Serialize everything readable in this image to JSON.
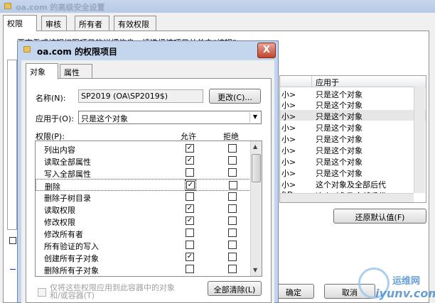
{
  "background_window": {
    "title": "oa.com 的高级安全设置",
    "tabs": [
      {
        "label": "权限",
        "active": true
      },
      {
        "label": "审核",
        "active": false
      },
      {
        "label": "所有者",
        "active": false
      },
      {
        "label": "有效权限",
        "active": false
      }
    ],
    "description": "要查看或编辑权限项目的详细信息，请选择该项目并单击“编辑”。",
    "list_header": {
      "applies_to": "应用于"
    },
    "list_rows": [
      {
        "prefix": "小>",
        "applies_to": "只是这个对象",
        "selected": false
      },
      {
        "prefix": "小>",
        "applies_to": "只是这个对象",
        "selected": false
      },
      {
        "prefix": "小>",
        "applies_to": "只是这个对象",
        "selected": true
      },
      {
        "prefix": "小>",
        "applies_to": "只是这个对象",
        "selected": false
      },
      {
        "prefix": "小>",
        "applies_to": "只是这个对象",
        "selected": false
      },
      {
        "prefix": "小>",
        "applies_to": "只是这个对象",
        "selected": false
      },
      {
        "prefix": "小>",
        "applies_to": "只是这个对象",
        "selected": false
      },
      {
        "prefix": "小>",
        "applies_to": "只是这个对象",
        "selected": false
      },
      {
        "prefix": "小>",
        "applies_to": "这个对象及全部后代",
        "selected": false
      },
      {
        "prefix": "ftD>",
        "applies_to": "这个对象及全部后代",
        "selected": false
      }
    ],
    "restore_defaults_button": "还原默认值(F)",
    "ok_button": "确定",
    "cancel_button": "取消"
  },
  "dialog": {
    "title": "oa.com 的权限项目",
    "close_label": "X",
    "tabs": [
      {
        "label": "对象",
        "active": true
      },
      {
        "label": "属性",
        "active": false
      }
    ],
    "name_label": "名称(N):",
    "name_value": "SP2019 (OA\\SP2019$)",
    "change_button": "更改(C)...",
    "apply_to_label": "应用于(O):",
    "apply_to_value": "只是这个对象",
    "permissions_label": "权限(P):",
    "allow_header": "允许",
    "deny_header": "拒绝",
    "check_mark": "✓",
    "permissions": [
      {
        "name": "列出内容",
        "allow": true,
        "deny": false
      },
      {
        "name": "读取全部属性",
        "allow": true,
        "deny": false
      },
      {
        "name": "写入全部属性",
        "allow": false,
        "deny": false
      },
      {
        "name": "删除",
        "allow": true,
        "deny": false
      },
      {
        "name": "删除子树目录",
        "allow": false,
        "deny": false
      },
      {
        "name": "读取权限",
        "allow": true,
        "deny": false
      },
      {
        "name": "修改权限",
        "allow": true,
        "deny": false
      },
      {
        "name": "修改所有者",
        "allow": false,
        "deny": false
      },
      {
        "name": "所有验证的写入",
        "allow": false,
        "deny": false
      },
      {
        "name": "创建所有子对象",
        "allow": true,
        "deny": false
      },
      {
        "name": "删除所有子对象",
        "allow": false,
        "deny": false
      }
    ],
    "apply_only_text_line1": "仅将这些权限应用到此容器中的对象",
    "apply_only_text_line2": "和/或容器(T)",
    "clear_all_button": "全部清除(L)"
  },
  "watermark": {
    "text_line1": "运维网",
    "text_line2": "iyunv.com"
  },
  "colors": {
    "dialog_frame": "#c4d5ee",
    "selection_row": "#e6e6e6",
    "close_button": "#c4432c"
  },
  "icons": [
    "folder-icon",
    "close-icon",
    "dropdown-arrow-icon",
    "scroll-up-icon",
    "scroll-down-icon",
    "checkbox-icon"
  ]
}
